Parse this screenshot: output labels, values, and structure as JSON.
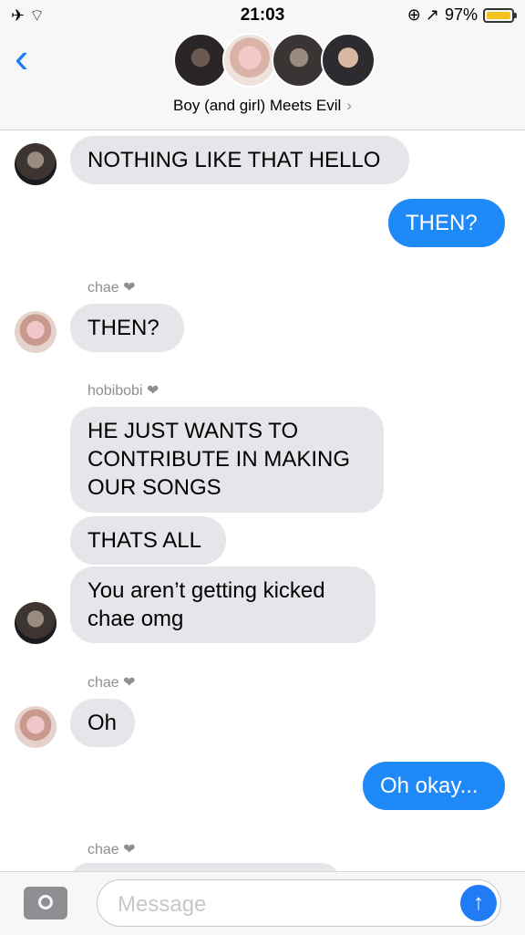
{
  "status_bar": {
    "time": "21:03",
    "battery_percent": "97%",
    "left_icons": "✈ ⌔",
    "right_icons": "⊕ ↗"
  },
  "header": {
    "back_icon": "chevron-left",
    "group_name": "Boy (and girl) Meets Evil",
    "chevron": "›"
  },
  "messages": {
    "m1": "NOTHING LIKE THAT HELLO",
    "m2": "THEN?",
    "sender_chae_1": "chae ❤",
    "m3": "THEN?",
    "sender_hobi": "hobibobi ❤",
    "m4": "HE JUST WANTS TO CONTRIBUTE IN MAKING OUR SONGS",
    "m5": "THATS ALL",
    "m6": "You aren’t getting kicked chae omg",
    "sender_chae_2": "chae ❤",
    "m7": "Oh",
    "m8": "Oh okay...",
    "sender_chae_3": "chae ❤"
  },
  "composer": {
    "placeholder": "Message",
    "send_icon": "↑"
  },
  "colors": {
    "accent": "#1f7cf5",
    "outgoing_bubble": "#1f8af7",
    "incoming_bubble": "#e5e5ea"
  }
}
